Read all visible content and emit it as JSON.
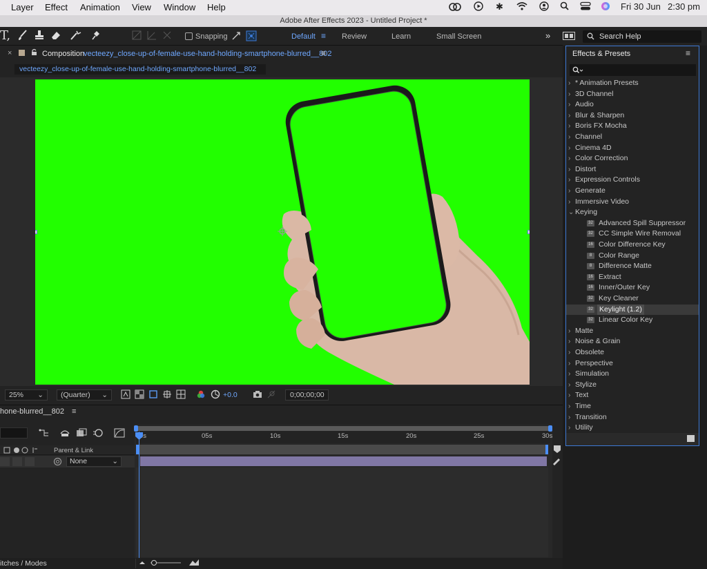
{
  "menubar": {
    "items": [
      "Layer",
      "Effect",
      "Animation",
      "View",
      "Window",
      "Help"
    ],
    "date": "Fri 30 Jun",
    "time": "2:30 pm"
  },
  "window": {
    "title": "Adobe After Effects 2023 - Untitled Project *"
  },
  "toolbar": {
    "snapping_label": "Snapping",
    "workspaces": [
      "Default",
      "Review",
      "Learn",
      "Small Screen"
    ],
    "search_help": "Search Help"
  },
  "composition": {
    "tab_prefix": "Composition",
    "name": "vecteezy_close-up-of-female-use-hand-holding-smartphone-blurred__802",
    "zoom": "25%",
    "resolution": "(Quarter)",
    "exposure": "+0.0",
    "timecode": "0;00;00;00"
  },
  "timeline": {
    "tab": "hone-blurred__802",
    "parent_link_header": "Parent & Link",
    "parent_value": "None",
    "ticks": [
      "0s",
      "05s",
      "10s",
      "15s",
      "20s",
      "25s",
      "30s"
    ],
    "footer_left": "itches / Modes"
  },
  "effects_presets": {
    "title": "Effects & Presets",
    "categories": [
      {
        "label": "* Animation Presets"
      },
      {
        "label": "3D Channel"
      },
      {
        "label": "Audio"
      },
      {
        "label": "Blur & Sharpen"
      },
      {
        "label": "Boris FX Mocha"
      },
      {
        "label": "Channel"
      },
      {
        "label": "Cinema 4D"
      },
      {
        "label": "Color Correction"
      },
      {
        "label": "Distort"
      },
      {
        "label": "Expression Controls"
      },
      {
        "label": "Generate"
      },
      {
        "label": "Immersive Video"
      },
      {
        "label": "Keying"
      }
    ],
    "keying_children": [
      {
        "label": "Advanced Spill Suppressor"
      },
      {
        "label": "CC Simple Wire Removal"
      },
      {
        "label": "Color Difference Key"
      },
      {
        "label": "Color Range"
      },
      {
        "label": "Difference Matte"
      },
      {
        "label": "Extract"
      },
      {
        "label": "Inner/Outer Key"
      },
      {
        "label": "Key Cleaner"
      },
      {
        "label": "Keylight (1.2)"
      },
      {
        "label": "Linear Color Key"
      }
    ],
    "categories_after": [
      {
        "label": "Matte"
      },
      {
        "label": "Noise & Grain"
      },
      {
        "label": "Obsolete"
      },
      {
        "label": "Perspective"
      },
      {
        "label": "Simulation"
      },
      {
        "label": "Stylize"
      },
      {
        "label": "Text"
      },
      {
        "label": "Time"
      },
      {
        "label": "Transition"
      },
      {
        "label": "Utility"
      }
    ]
  },
  "colors": {
    "accent": "#3e7ad6",
    "green_screen": "#22ff00",
    "layer_bar": "#8077a5"
  }
}
